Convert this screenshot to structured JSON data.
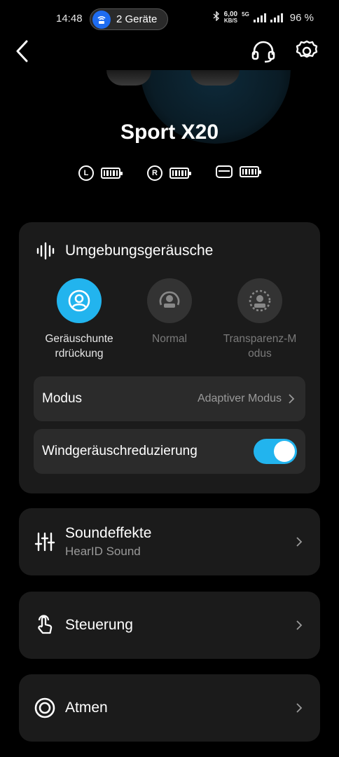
{
  "status_bar": {
    "time": "14:48",
    "devices": "2 Geräte",
    "speed_value": "6,00",
    "speed_unit": "KB/S",
    "network": "5G",
    "battery": "96 %"
  },
  "product": {
    "name": "Sport X20",
    "left_badge": "L",
    "right_badge": "R"
  },
  "ambient": {
    "title": "Umgebungsgeräusche",
    "modes": [
      {
        "label": "Geräuschunte rdrückung",
        "active": true
      },
      {
        "label": "Normal",
        "active": false
      },
      {
        "label": "Transparenz-M odus",
        "active": false
      }
    ],
    "mode_row": {
      "label": "Modus",
      "value": "Adaptiver Modus"
    },
    "wind_row": {
      "label": "Windgeräuschreduzierung",
      "enabled": true
    }
  },
  "menu": {
    "sound": {
      "title": "Soundeffekte",
      "subtitle": "HearID Sound"
    },
    "control": {
      "title": "Steuerung"
    },
    "breathe": {
      "title": "Atmen"
    }
  },
  "colors": {
    "accent": "#22b4ee",
    "card": "#1b1b1b",
    "row": "#2b2b2b"
  },
  "icons": [
    "back-icon",
    "headset-icon",
    "gear-icon",
    "waveform-icon",
    "sliders-icon",
    "touch-icon",
    "breathe-icon",
    "chevron-right-icon"
  ]
}
